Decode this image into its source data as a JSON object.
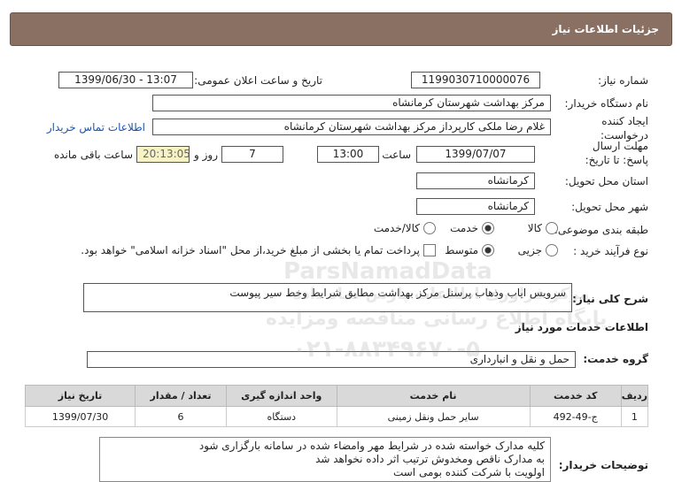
{
  "header": {
    "title": "جزئیات اطلاعات نیاز"
  },
  "fields": {
    "need_number_label": "شماره نیاز:",
    "need_number": "1199030710000076",
    "announce_label": "تاریخ و ساعت اعلان عمومی:",
    "announce_value": "1399/06/30 - 13:07",
    "buyer_label": "نام دستگاه خریدار:",
    "buyer_value": "مرکز بهداشت شهرستان کرمانشاه",
    "creator_label": "ایجاد کننده درخواست:",
    "creator_value": "غلام رضا ملکی کارپرداز مرکز بهداشت شهرستان کرمانشاه",
    "contact_link": "اطلاعات تماس خریدار",
    "deadline_label": "مهلت ارسال پاسخ: تا تاریخ:",
    "deadline_date": "1399/07/07",
    "time_label": "ساعت",
    "deadline_time": "13:00",
    "days_value": "7",
    "days_label": "روز و",
    "remaining_time": "20:13:05",
    "remaining_label": "ساعت باقی مانده",
    "province_label": "استان محل تحویل:",
    "province_value": "کرمانشاه",
    "city_label": "شهر محل تحویل:",
    "city_value": "کرمانشاه",
    "category_label": "طبقه بندی موضوعی:",
    "category_options": [
      "کالا",
      "خدمت",
      "کالا/خدمت"
    ],
    "category_selected": 1,
    "process_label": "نوع فرآیند خرید :",
    "process_options": [
      "جزیی",
      "متوسط"
    ],
    "process_selected": 1,
    "payment_note": "پرداخت تمام یا بخشی از مبلغ خرید،از محل \"اسناد خزانه اسلامی\" خواهد بود."
  },
  "description": {
    "label": "شرح کلی نیاز:",
    "value": "سرویس ایاب وذهاب پرسنل مرکز بهداشت مطابق شرایط وخط سیر پیوست"
  },
  "services_section": {
    "title": "اطلاعات خدمات مورد نیاز",
    "group_label": "گروه خدمت:",
    "group_value": "حمل و نقل و انبارداری"
  },
  "table": {
    "headers": [
      "ردیف",
      "کد خدمت",
      "نام خدمت",
      "واحد اندازه گیری",
      "تعداد / مقدار",
      "تاریخ نیاز"
    ],
    "rows": [
      [
        "1",
        "ج-49-492",
        "سایر حمل ونقل زمینی",
        "دستگاه",
        "6",
        "1399/07/30"
      ]
    ]
  },
  "buyer_notes": {
    "label": "توضیحات خریدار:",
    "lines": [
      "کلیه مدارک خواسته شده در شرایط مهر وامضاء شده در سامانه بارگزاری شود",
      "به مدارک ناقص ومخدوش ترتیب اثر داده نخواهد شد",
      "اولویت با شرکت کننده بومی است"
    ]
  },
  "watermark": {
    "line1": "ParsNamadData",
    "line2": "مرکز فراوری اطلاعات پارس نماد داده",
    "line3": "پایگاه اطلاع رسانی مناقصه ومزایده",
    "line4": "۰۲۱-۸۸۳۴۹۶۷۰-۵"
  }
}
